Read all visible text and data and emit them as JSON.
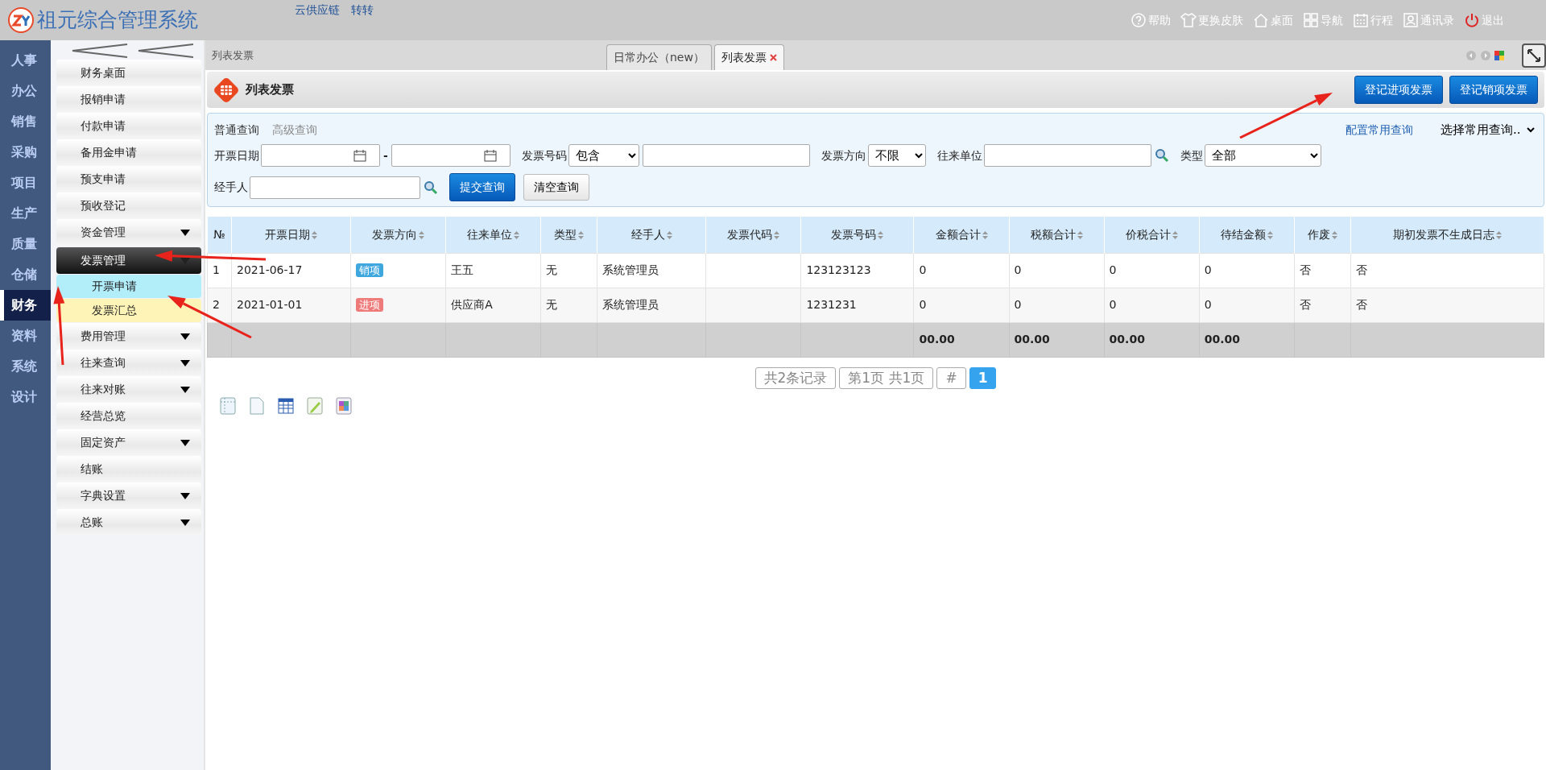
{
  "app": {
    "title": "祖元综合管理系统",
    "links": [
      "云供应链",
      "转转"
    ],
    "toolbar": [
      "帮助",
      "更换皮肤",
      "桌面",
      "导航",
      "行程",
      "通讯录",
      "退出"
    ]
  },
  "modules": [
    {
      "label": "人事",
      "selected": false
    },
    {
      "label": "办公",
      "selected": false
    },
    {
      "label": "销售",
      "selected": false
    },
    {
      "label": "采购",
      "selected": false
    },
    {
      "label": "项目",
      "selected": false
    },
    {
      "label": "生产",
      "selected": false
    },
    {
      "label": "质量",
      "selected": false
    },
    {
      "label": "仓储",
      "selected": false
    },
    {
      "label": "财务",
      "selected": true
    },
    {
      "label": "资料",
      "selected": false
    },
    {
      "label": "系统",
      "selected": false
    },
    {
      "label": "设计",
      "selected": false
    }
  ],
  "menu": [
    {
      "label": "财务桌面",
      "expandable": false
    },
    {
      "label": "报销申请",
      "expandable": false
    },
    {
      "label": "付款申请",
      "expandable": false
    },
    {
      "label": "备用金申请",
      "expandable": false
    },
    {
      "label": "预支申请",
      "expandable": false
    },
    {
      "label": "预收登记",
      "expandable": false
    },
    {
      "label": "资金管理",
      "expandable": true,
      "expanded": false
    },
    {
      "label": "发票管理",
      "expandable": true,
      "expanded": true,
      "children": [
        {
          "label": "开票申请",
          "color": "#b2eefa"
        },
        {
          "label": "发票汇总",
          "color": "#fff4b8"
        }
      ]
    },
    {
      "label": "费用管理",
      "expandable": true,
      "expanded": false
    },
    {
      "label": "往来查询",
      "expandable": true,
      "expanded": false
    },
    {
      "label": "往来对账",
      "expandable": true,
      "expanded": false
    },
    {
      "label": "经营总览",
      "expandable": false
    },
    {
      "label": "固定资产",
      "expandable": true,
      "expanded": false
    },
    {
      "label": "结账",
      "expandable": false
    },
    {
      "label": "字典设置",
      "expandable": true,
      "expanded": false
    },
    {
      "label": "总账",
      "expandable": true,
      "expanded": false
    }
  ],
  "breadcrumb": "列表发票",
  "tabs": [
    {
      "label": "日常办公（new）",
      "selected": false,
      "closable": false
    },
    {
      "label": "列表发票",
      "selected": true,
      "closable": true
    }
  ],
  "page": {
    "title": "列表发票",
    "buttons": [
      "登记进项发票",
      "登记销项发票"
    ]
  },
  "filter": {
    "tabs": [
      {
        "label": "普通查询",
        "selected": true
      },
      {
        "label": "高级查询",
        "selected": false
      }
    ],
    "config_link": "配置常用查询",
    "saved_query": "选择常用查询..",
    "fields": [
      {
        "kind": "date_range",
        "label": "开票日期",
        "separator": "-"
      },
      {
        "kind": "select_text",
        "label": "发票号码",
        "value": "包含"
      },
      {
        "kind": "select",
        "label": "发票方向",
        "value": "不限"
      },
      {
        "kind": "lookup",
        "label": "往来单位"
      },
      {
        "kind": "select",
        "label": "类型",
        "value": "全部"
      },
      {
        "kind": "lookup",
        "label": "经手人"
      }
    ],
    "buttons": [
      {
        "label": "提交查询",
        "primary": true
      },
      {
        "label": "清空查询",
        "primary": false
      }
    ]
  },
  "table": {
    "columns": [
      "№",
      "开票日期",
      "发票方向",
      "往来单位",
      "类型",
      "经手人",
      "发票代码",
      "发票号码",
      "金额合计",
      "税额合计",
      "价税合计",
      "待结金额",
      "作废",
      "期初发票不生成日志"
    ],
    "rows": [
      {
        "no": "1",
        "date": "2021-06-17",
        "direction": "销项",
        "color": "#3ea7de",
        "party": "王五",
        "type": "无",
        "handler": "系统管理员",
        "number": "123123123",
        "amount": "0",
        "tax": "0",
        "total": "0",
        "pending": "0",
        "void": "否",
        "no_log": "否"
      },
      {
        "no": "2",
        "date": "2021-01-01",
        "direction": "进项",
        "color": "#ef7a7a",
        "party": "供应商A",
        "type": "无",
        "handler": "系统管理员",
        "number": "1231231",
        "amount": "0",
        "tax": "0",
        "total": "0",
        "pending": "0",
        "void": "否",
        "no_log": "否"
      }
    ],
    "summary": {
      "amount": "00.00",
      "tax": "00.00",
      "total": "00.00",
      "pending": "00.00"
    }
  },
  "pagination": {
    "info": [
      "共2条记录",
      "第1页 共1页",
      "#"
    ],
    "pages": [
      {
        "label": "1",
        "selected": true
      }
    ]
  },
  "annotation_arrows": [
    {
      "kind": "arrow"
    },
    {
      "kind": "arrow"
    },
    {
      "kind": "arrow"
    },
    {
      "kind": "arrow"
    }
  ]
}
